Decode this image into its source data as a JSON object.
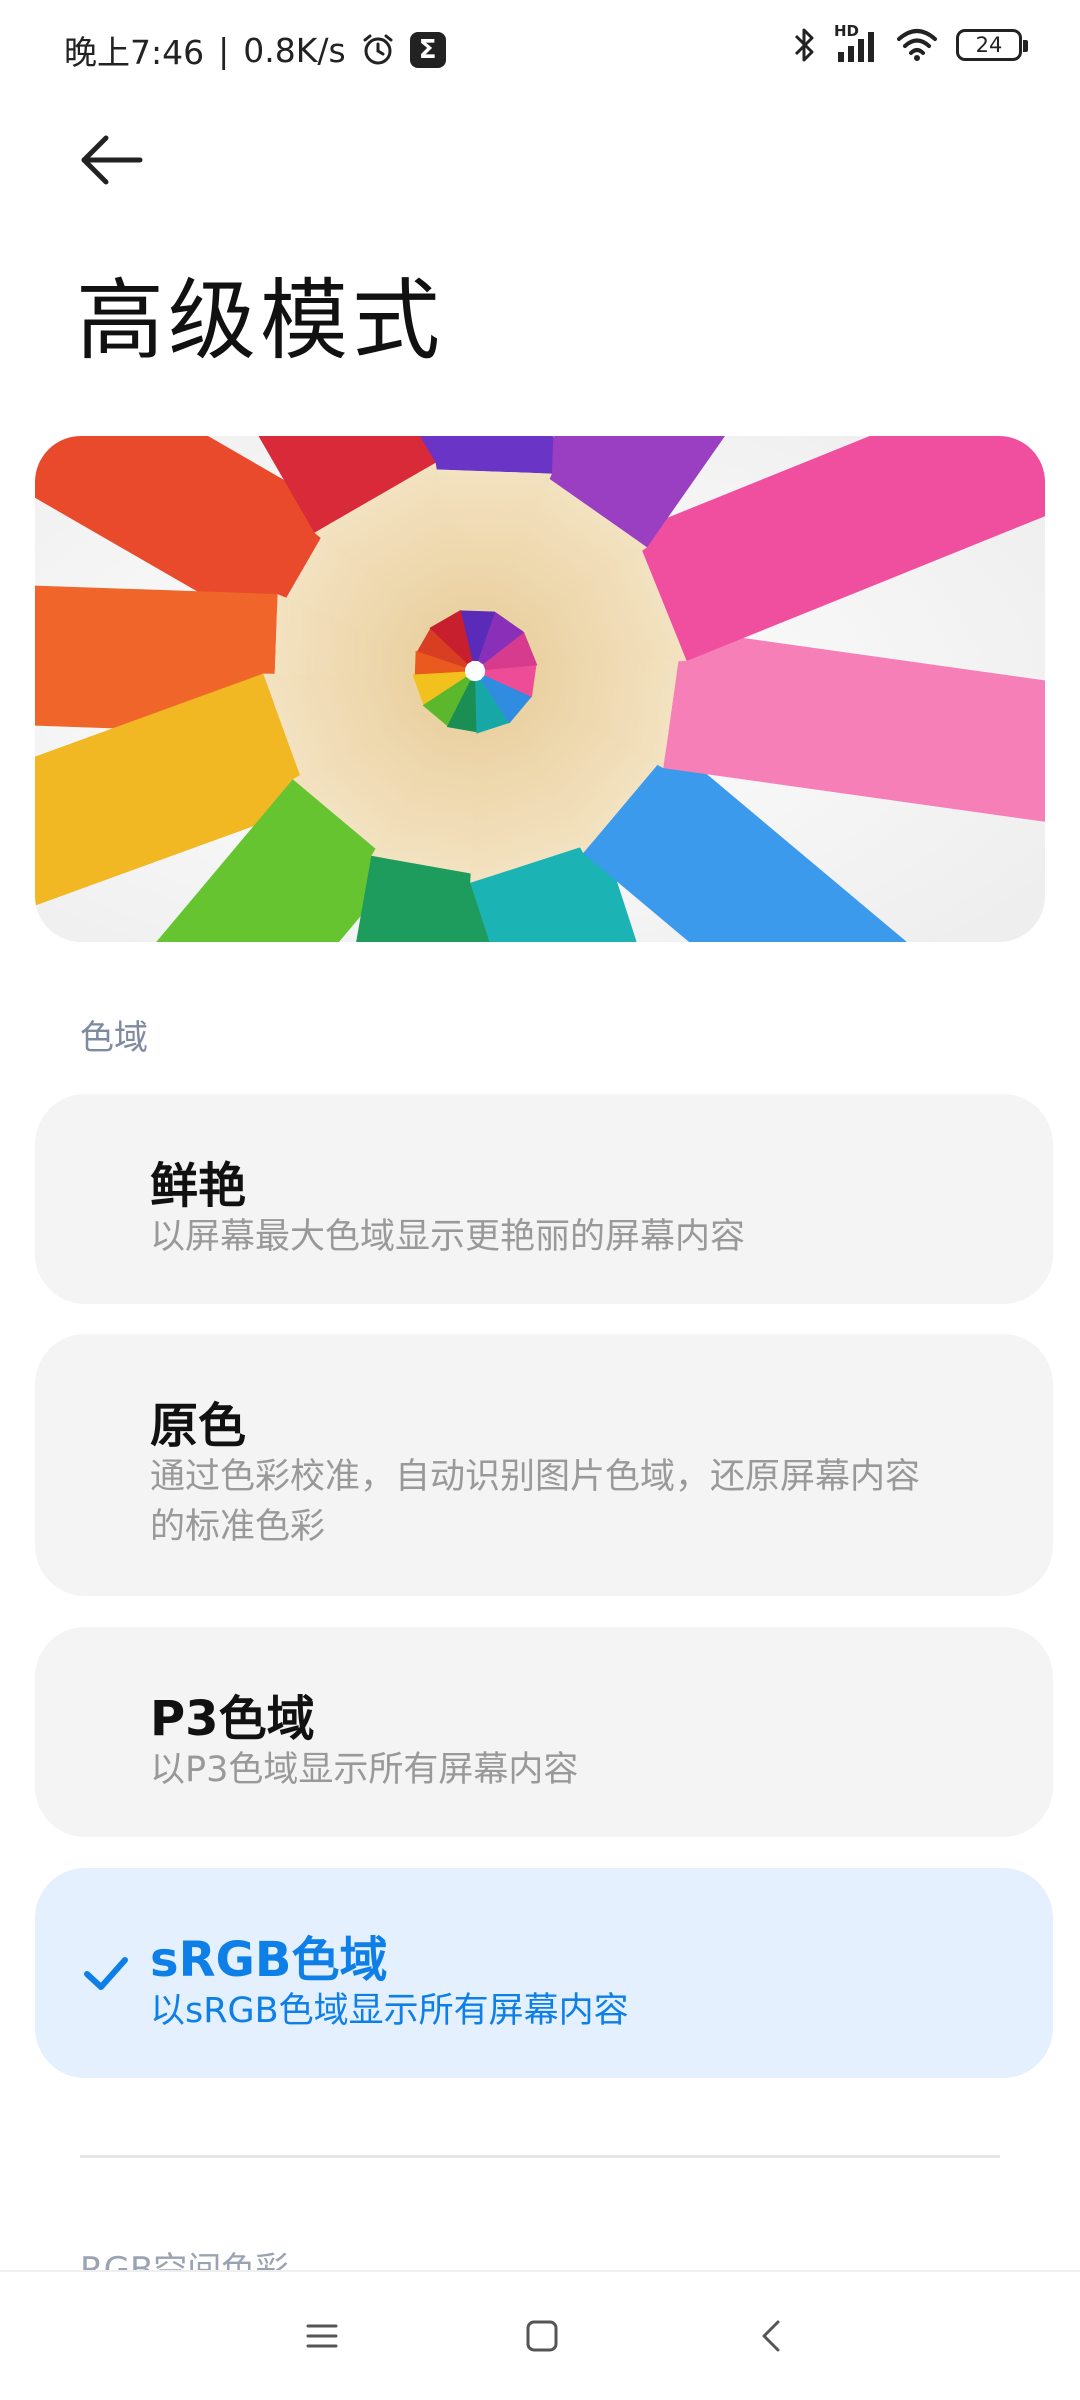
{
  "status": {
    "time": "晚上7:46",
    "separator": "|",
    "speed": "0.8K/s",
    "battery": "24",
    "network": "HD"
  },
  "page": {
    "title": "高级模式"
  },
  "section": {
    "label": "色域"
  },
  "options": [
    {
      "title": "鲜艳",
      "desc": "以屏幕最大色域显示更艳丽的屏幕内容",
      "selected": false
    },
    {
      "title": "原色",
      "desc": "通过色彩校准，自动识别图片色域，还原屏幕内容的标准色彩",
      "selected": false
    },
    {
      "title": "P3色域",
      "desc": "以P3色域显示所有屏幕内容",
      "selected": false
    },
    {
      "title": "sRGB色域",
      "desc": "以sRGB色域显示所有屏幕内容",
      "selected": true
    }
  ],
  "next_section": {
    "label": "RGB空间色彩"
  },
  "colors": {
    "accent": "#0f7fe8",
    "selected_bg": "#e4f0fd",
    "card_bg": "#f4f4f4",
    "section_label": "#7e8aa0"
  },
  "icons": {
    "back": "arrow-left-icon",
    "alarm": "alarm-icon",
    "app": "sigma-app-icon",
    "bluetooth": "bluetooth-icon",
    "signal": "signal-icon",
    "wifi": "wifi-icon",
    "check": "check-icon",
    "menu": "menu-icon",
    "home": "home-icon",
    "nav_back": "nav-back-icon"
  }
}
